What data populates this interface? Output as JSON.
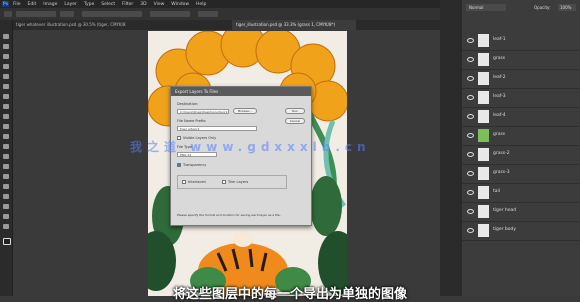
{
  "menubar": {
    "items": [
      "File",
      "Edit",
      "Image",
      "Layer",
      "Type",
      "Select",
      "Filter",
      "3D",
      "View",
      "Window",
      "Help"
    ]
  },
  "tabs": [
    {
      "label": "tiger whatever illustration.psd @ 30.5% (tiger, CMYK/8)"
    },
    {
      "label": "tiger_illustration.psd @ 33.3% (grass 1, CMYK/8*)"
    }
  ],
  "dialog": {
    "title": "Export Layers To Files",
    "destination_label": "Destination:",
    "destination_value": "C:\\Users\\Shaw\\Desktop\\artwork",
    "browse_label": "Browse...",
    "run_label": "Run",
    "cancel_label": "Cancel",
    "prefix_label": "File Name Prefix:",
    "prefix_value": "tiger artwork",
    "visible_only_label": "Visible Layers Only",
    "options_label": "File Type:",
    "file_type_value": "PNG-24",
    "transparency_label": "Transparency",
    "interlaced_label": "Interlaced",
    "trim_label": "Trim Layers",
    "help_text": "Please specify the format and location for saving each layer as a file."
  },
  "panel": {
    "mode_value": "Normal",
    "opacity_label": "Opacity:",
    "opacity_value": "100%",
    "layers": [
      {
        "name": "leaf-1"
      },
      {
        "name": "grass"
      },
      {
        "name": "leaf-2"
      },
      {
        "name": "leaf-3"
      },
      {
        "name": "leaf-4"
      },
      {
        "name": "grass"
      },
      {
        "name": "grass-2"
      },
      {
        "name": "grass-3"
      },
      {
        "name": "tail"
      },
      {
        "name": "tiger head"
      },
      {
        "name": "tiger body"
      }
    ]
  },
  "watermark": "我之道 www.gdxxxlb.cn",
  "subtitle": "将这些图层中的每一个导出为单独的图像"
}
